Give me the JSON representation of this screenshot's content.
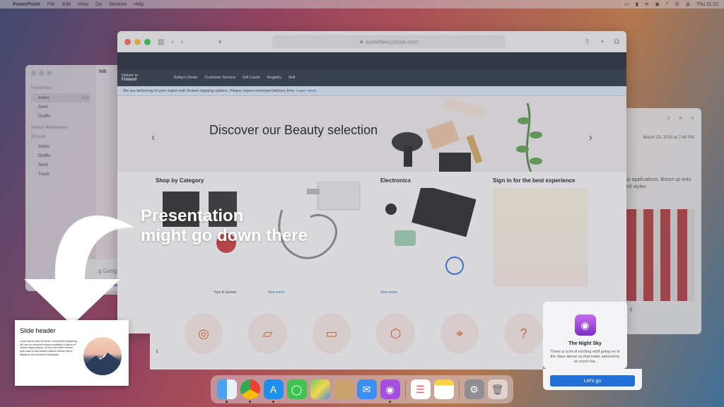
{
  "menubar": {
    "app": "PowerPoint",
    "items": [
      "File",
      "Edit",
      "View",
      "Go",
      "Window",
      "Help"
    ],
    "clock": "Thu 11:22"
  },
  "mail": {
    "sections": {
      "favorites": "Favorites",
      "smart": "Smart Mailboxes",
      "icloud": "iCloud"
    },
    "favorites": [
      {
        "label": "Inbox",
        "count": "121"
      },
      {
        "label": "Sent"
      },
      {
        "label": "Drafts"
      }
    ],
    "icloud": [
      {
        "label": "Inbox"
      },
      {
        "label": "Drafts"
      },
      {
        "label": "Sent"
      },
      {
        "label": "Trash"
      }
    ],
    "list_header": "Inb"
  },
  "reader": {
    "date": "March 23, 2018 at 7:48 PM",
    "text": "top applications. Boost up ents and styles."
  },
  "browser": {
    "url": "somefancystore.com",
    "deliver_line1": "Deliver to",
    "deliver_line2": "Finland",
    "nav": [
      "Today's Deals",
      "Customer Service",
      "Gift Cards",
      "Registry",
      "Sell"
    ],
    "notice": "We are delivering to your region with limited shipping options. Please expect extended delivery time.",
    "notice_link": "Learn more.",
    "hero_title": "Discover our Beauty selection",
    "cards": [
      {
        "title": "Shop by Category",
        "caption": "Toys & Games"
      },
      {
        "title": "",
        "see_more": "See more"
      },
      {
        "title": "Electronics",
        "see_more": "See more"
      },
      {
        "title": "Sign in for the best experience"
      }
    ]
  },
  "chrome_download": {
    "label": "g Google Chrome..."
  },
  "callout": {
    "line1": "Presentation",
    "line2": "might go down there"
  },
  "slide": {
    "header": "Slide header",
    "body": "Lorem ipsum dolor sit amet, consectetur adipiscing elit, sed do eiusmod tempor incididunt ut labore et dolore magna aliqua. Ut enim ad minim veniam, quis nostrud exercitation ullamco laboris nisi ut aliquip ex ea commodo consequat."
  },
  "notification": {
    "title": "The Night Sky",
    "body": "There is a lot of exciting stuff going on in the stars above us that make astronomy so much fun.",
    "button": "Let's go"
  },
  "dock": {
    "apps": [
      "finder-icon",
      "chrome-icon",
      "app-store-icon",
      "messages-icon",
      "maps-icon",
      "contacts-icon",
      "mail-icon",
      "podcasts-icon",
      "reminders-icon",
      "notes-icon",
      "system-preferences-icon",
      "trash-icon"
    ]
  }
}
